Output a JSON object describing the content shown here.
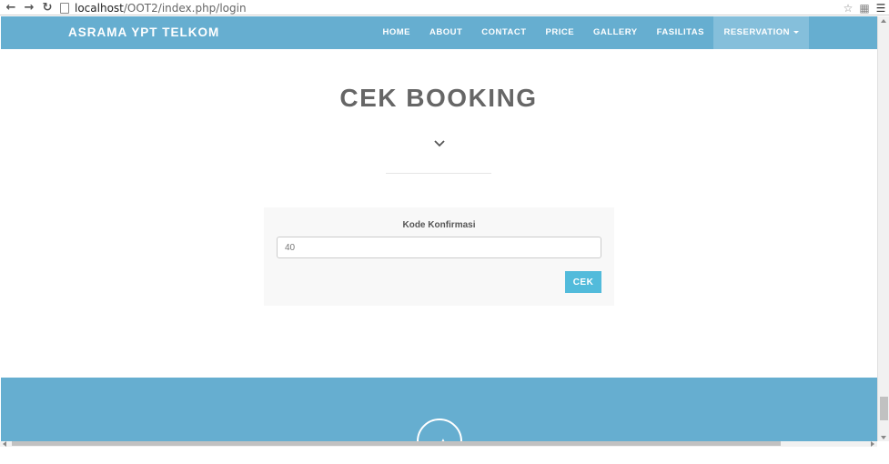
{
  "browser": {
    "url_host": "localhost",
    "url_path": "/OOT2/index.php/login"
  },
  "navbar": {
    "brand": "ASRAMA YPT TELKOM",
    "items": [
      {
        "label": "HOME"
      },
      {
        "label": "ABOUT"
      },
      {
        "label": "CONTACT"
      },
      {
        "label": "PRICE"
      },
      {
        "label": "GALLERY"
      },
      {
        "label": "FASILITAS"
      },
      {
        "label": "RESERVATION"
      }
    ],
    "active_item": "RESERVATION"
  },
  "main": {
    "title": "CEK BOOKING",
    "form": {
      "label": "Kode Konfirmasi",
      "input_value": "40",
      "submit_label": "CEK"
    }
  },
  "colors": {
    "navbar_bg": "#66aed0",
    "active_nav_bg": "#85bfdb",
    "button_bg": "#52bbdb",
    "title_color": "#666666",
    "footer_bg": "#66aed0"
  },
  "icons": {
    "back": "arrow-left-icon",
    "forward": "arrow-right-icon",
    "reload": "reload-icon",
    "page": "page-icon",
    "star": "star-icon",
    "extension": "extension-icon",
    "menu": "hamburger-menu-icon",
    "chevron": "chevron-down-icon",
    "scroll_top": "scroll-top-icon"
  }
}
